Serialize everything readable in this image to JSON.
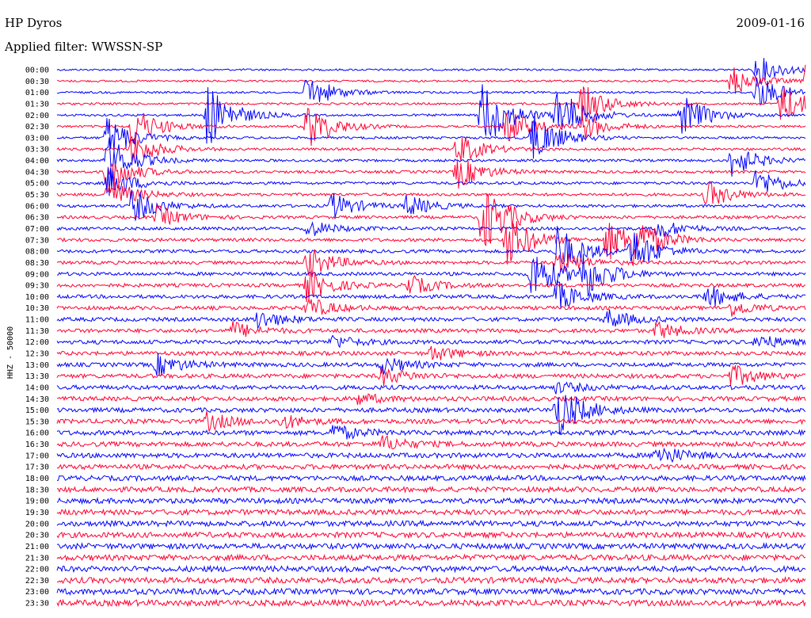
{
  "header": {
    "station": "HP Dyros",
    "date": "2009-01-16",
    "filter": "Applied filter: WWSSN-SP",
    "channel": "HHZ - 50000"
  },
  "colors": {
    "odd_trace": "#0000ff",
    "even_trace": "#ff0033"
  },
  "chart_data": {
    "type": "line",
    "title": "HP Dyros",
    "date": "2009-01-16",
    "filter": "WWSSN-SP",
    "ylabel": "HHZ - 50000",
    "row_labels": [
      "00:00",
      "00:30",
      "01:00",
      "01:30",
      "02:00",
      "02:30",
      "03:00",
      "03:30",
      "04:00",
      "04:30",
      "05:00",
      "05:30",
      "06:00",
      "06:30",
      "07:00",
      "07:30",
      "08:00",
      "08:30",
      "09:00",
      "09:30",
      "10:00",
      "10:30",
      "11:00",
      "11:30",
      "12:00",
      "12:30",
      "13:00",
      "13:30",
      "14:00",
      "14:30",
      "15:00",
      "15:30",
      "16:00",
      "16:30",
      "17:00",
      "17:30",
      "18:00",
      "18:30",
      "19:00",
      "19:30",
      "20:00",
      "20:30",
      "21:00",
      "21:30",
      "22:00",
      "22:30",
      "23:00",
      "23:30"
    ],
    "row_minutes": 30,
    "trace_colors": [
      "#0000ff",
      "#ff0033"
    ],
    "events": [
      {
        "row": 0,
        "minute": 28,
        "amplitude": 1.4
      },
      {
        "row": 0,
        "minute": 59,
        "amplitude": 2.2
      },
      {
        "row": 0,
        "minute": 42,
        "amplitude": 0.9
      },
      {
        "row": 1,
        "minute": 30,
        "amplitude": 1.8
      },
      {
        "row": 1,
        "minute": 27,
        "amplitude": 1.5
      },
      {
        "row": 2,
        "minute": 10,
        "amplitude": 1.7
      },
      {
        "row": 2,
        "minute": 28,
        "amplitude": 1.6
      },
      {
        "row": 2,
        "minute": 48,
        "amplitude": 0.8
      },
      {
        "row": 3,
        "minute": 21,
        "amplitude": 1.9
      },
      {
        "row": 3,
        "minute": 29,
        "amplitude": 1.9
      },
      {
        "row": 4,
        "minute": 6,
        "amplitude": 3.0
      },
      {
        "row": 4,
        "minute": 17,
        "amplitude": 3.4
      },
      {
        "row": 4,
        "minute": 20,
        "amplitude": 2.6
      },
      {
        "row": 4,
        "minute": 25,
        "amplitude": 2.0
      },
      {
        "row": 5,
        "minute": 3,
        "amplitude": 2.0
      },
      {
        "row": 5,
        "minute": 10,
        "amplitude": 2.2
      },
      {
        "row": 5,
        "minute": 18,
        "amplitude": 1.7
      },
      {
        "row": 5,
        "minute": 21,
        "amplitude": 1.4
      },
      {
        "row": 6,
        "minute": 2,
        "amplitude": 2.0
      },
      {
        "row": 6,
        "minute": 19,
        "amplitude": 2.5
      },
      {
        "row": 7,
        "minute": 3,
        "amplitude": 1.6
      },
      {
        "row": 7,
        "minute": 16,
        "amplitude": 1.5
      },
      {
        "row": 8,
        "minute": 2,
        "amplitude": 2.4
      },
      {
        "row": 8,
        "minute": 27,
        "amplitude": 1.6
      },
      {
        "row": 9,
        "minute": 2,
        "amplitude": 1.8
      },
      {
        "row": 9,
        "minute": 16,
        "amplitude": 1.6
      },
      {
        "row": 10,
        "minute": 2,
        "amplitude": 1.5
      },
      {
        "row": 10,
        "minute": 28,
        "amplitude": 1.4
      },
      {
        "row": 11,
        "minute": 2,
        "amplitude": 1.6
      },
      {
        "row": 11,
        "minute": 26,
        "amplitude": 1.3
      },
      {
        "row": 12,
        "minute": 3,
        "amplitude": 1.6
      },
      {
        "row": 12,
        "minute": 11,
        "amplitude": 1.2
      },
      {
        "row": 12,
        "minute": 14,
        "amplitude": 1.0
      },
      {
        "row": 13,
        "minute": 4,
        "amplitude": 1.0
      },
      {
        "row": 13,
        "minute": 17,
        "amplitude": 3.5
      },
      {
        "row": 14,
        "minute": 10,
        "amplitude": 0.8
      },
      {
        "row": 14,
        "minute": 24,
        "amplitude": 1.0
      },
      {
        "row": 15,
        "minute": 18,
        "amplitude": 2.5
      },
      {
        "row": 15,
        "minute": 22,
        "amplitude": 2.0
      },
      {
        "row": 15,
        "minute": 23,
        "amplitude": 2.2
      },
      {
        "row": 16,
        "minute": 20,
        "amplitude": 2.5
      },
      {
        "row": 16,
        "minute": 23,
        "amplitude": 2.0
      },
      {
        "row": 17,
        "minute": 10,
        "amplitude": 1.5
      },
      {
        "row": 17,
        "minute": 20,
        "amplitude": 1.2
      },
      {
        "row": 18,
        "minute": 19,
        "amplitude": 2.5
      },
      {
        "row": 18,
        "minute": 21,
        "amplitude": 2.4
      },
      {
        "row": 19,
        "minute": 10,
        "amplitude": 1.5
      },
      {
        "row": 19,
        "minute": 14,
        "amplitude": 1.0
      },
      {
        "row": 20,
        "minute": 20,
        "amplitude": 1.4
      },
      {
        "row": 20,
        "minute": 26,
        "amplitude": 1.1
      },
      {
        "row": 21,
        "minute": 10,
        "amplitude": 1.0
      },
      {
        "row": 21,
        "minute": 27,
        "amplitude": 0.7
      },
      {
        "row": 22,
        "minute": 8,
        "amplitude": 0.9
      },
      {
        "row": 22,
        "minute": 22,
        "amplitude": 0.9
      },
      {
        "row": 23,
        "minute": 7,
        "amplitude": 0.8
      },
      {
        "row": 23,
        "minute": 24,
        "amplitude": 0.8
      },
      {
        "row": 24,
        "minute": 11,
        "amplitude": 0.6
      },
      {
        "row": 24,
        "minute": 28,
        "amplitude": 0.7
      },
      {
        "row": 25,
        "minute": 15,
        "amplitude": 0.7
      },
      {
        "row": 26,
        "minute": 4,
        "amplitude": 1.0
      },
      {
        "row": 26,
        "minute": 13,
        "amplitude": 0.8
      },
      {
        "row": 27,
        "minute": 13,
        "amplitude": 0.8
      },
      {
        "row": 27,
        "minute": 27,
        "amplitude": 1.0
      },
      {
        "row": 28,
        "minute": 20,
        "amplitude": 0.5
      },
      {
        "row": 29,
        "minute": 12,
        "amplitude": 0.5
      },
      {
        "row": 30,
        "minute": 20,
        "amplitude": 2.5
      },
      {
        "row": 31,
        "minute": 6,
        "amplitude": 0.8
      },
      {
        "row": 31,
        "minute": 9,
        "amplitude": 0.6
      },
      {
        "row": 32,
        "minute": 11,
        "amplitude": 0.8
      },
      {
        "row": 33,
        "minute": 13,
        "amplitude": 0.7
      },
      {
        "row": 34,
        "minute": 24,
        "amplitude": 1.0
      }
    ]
  }
}
